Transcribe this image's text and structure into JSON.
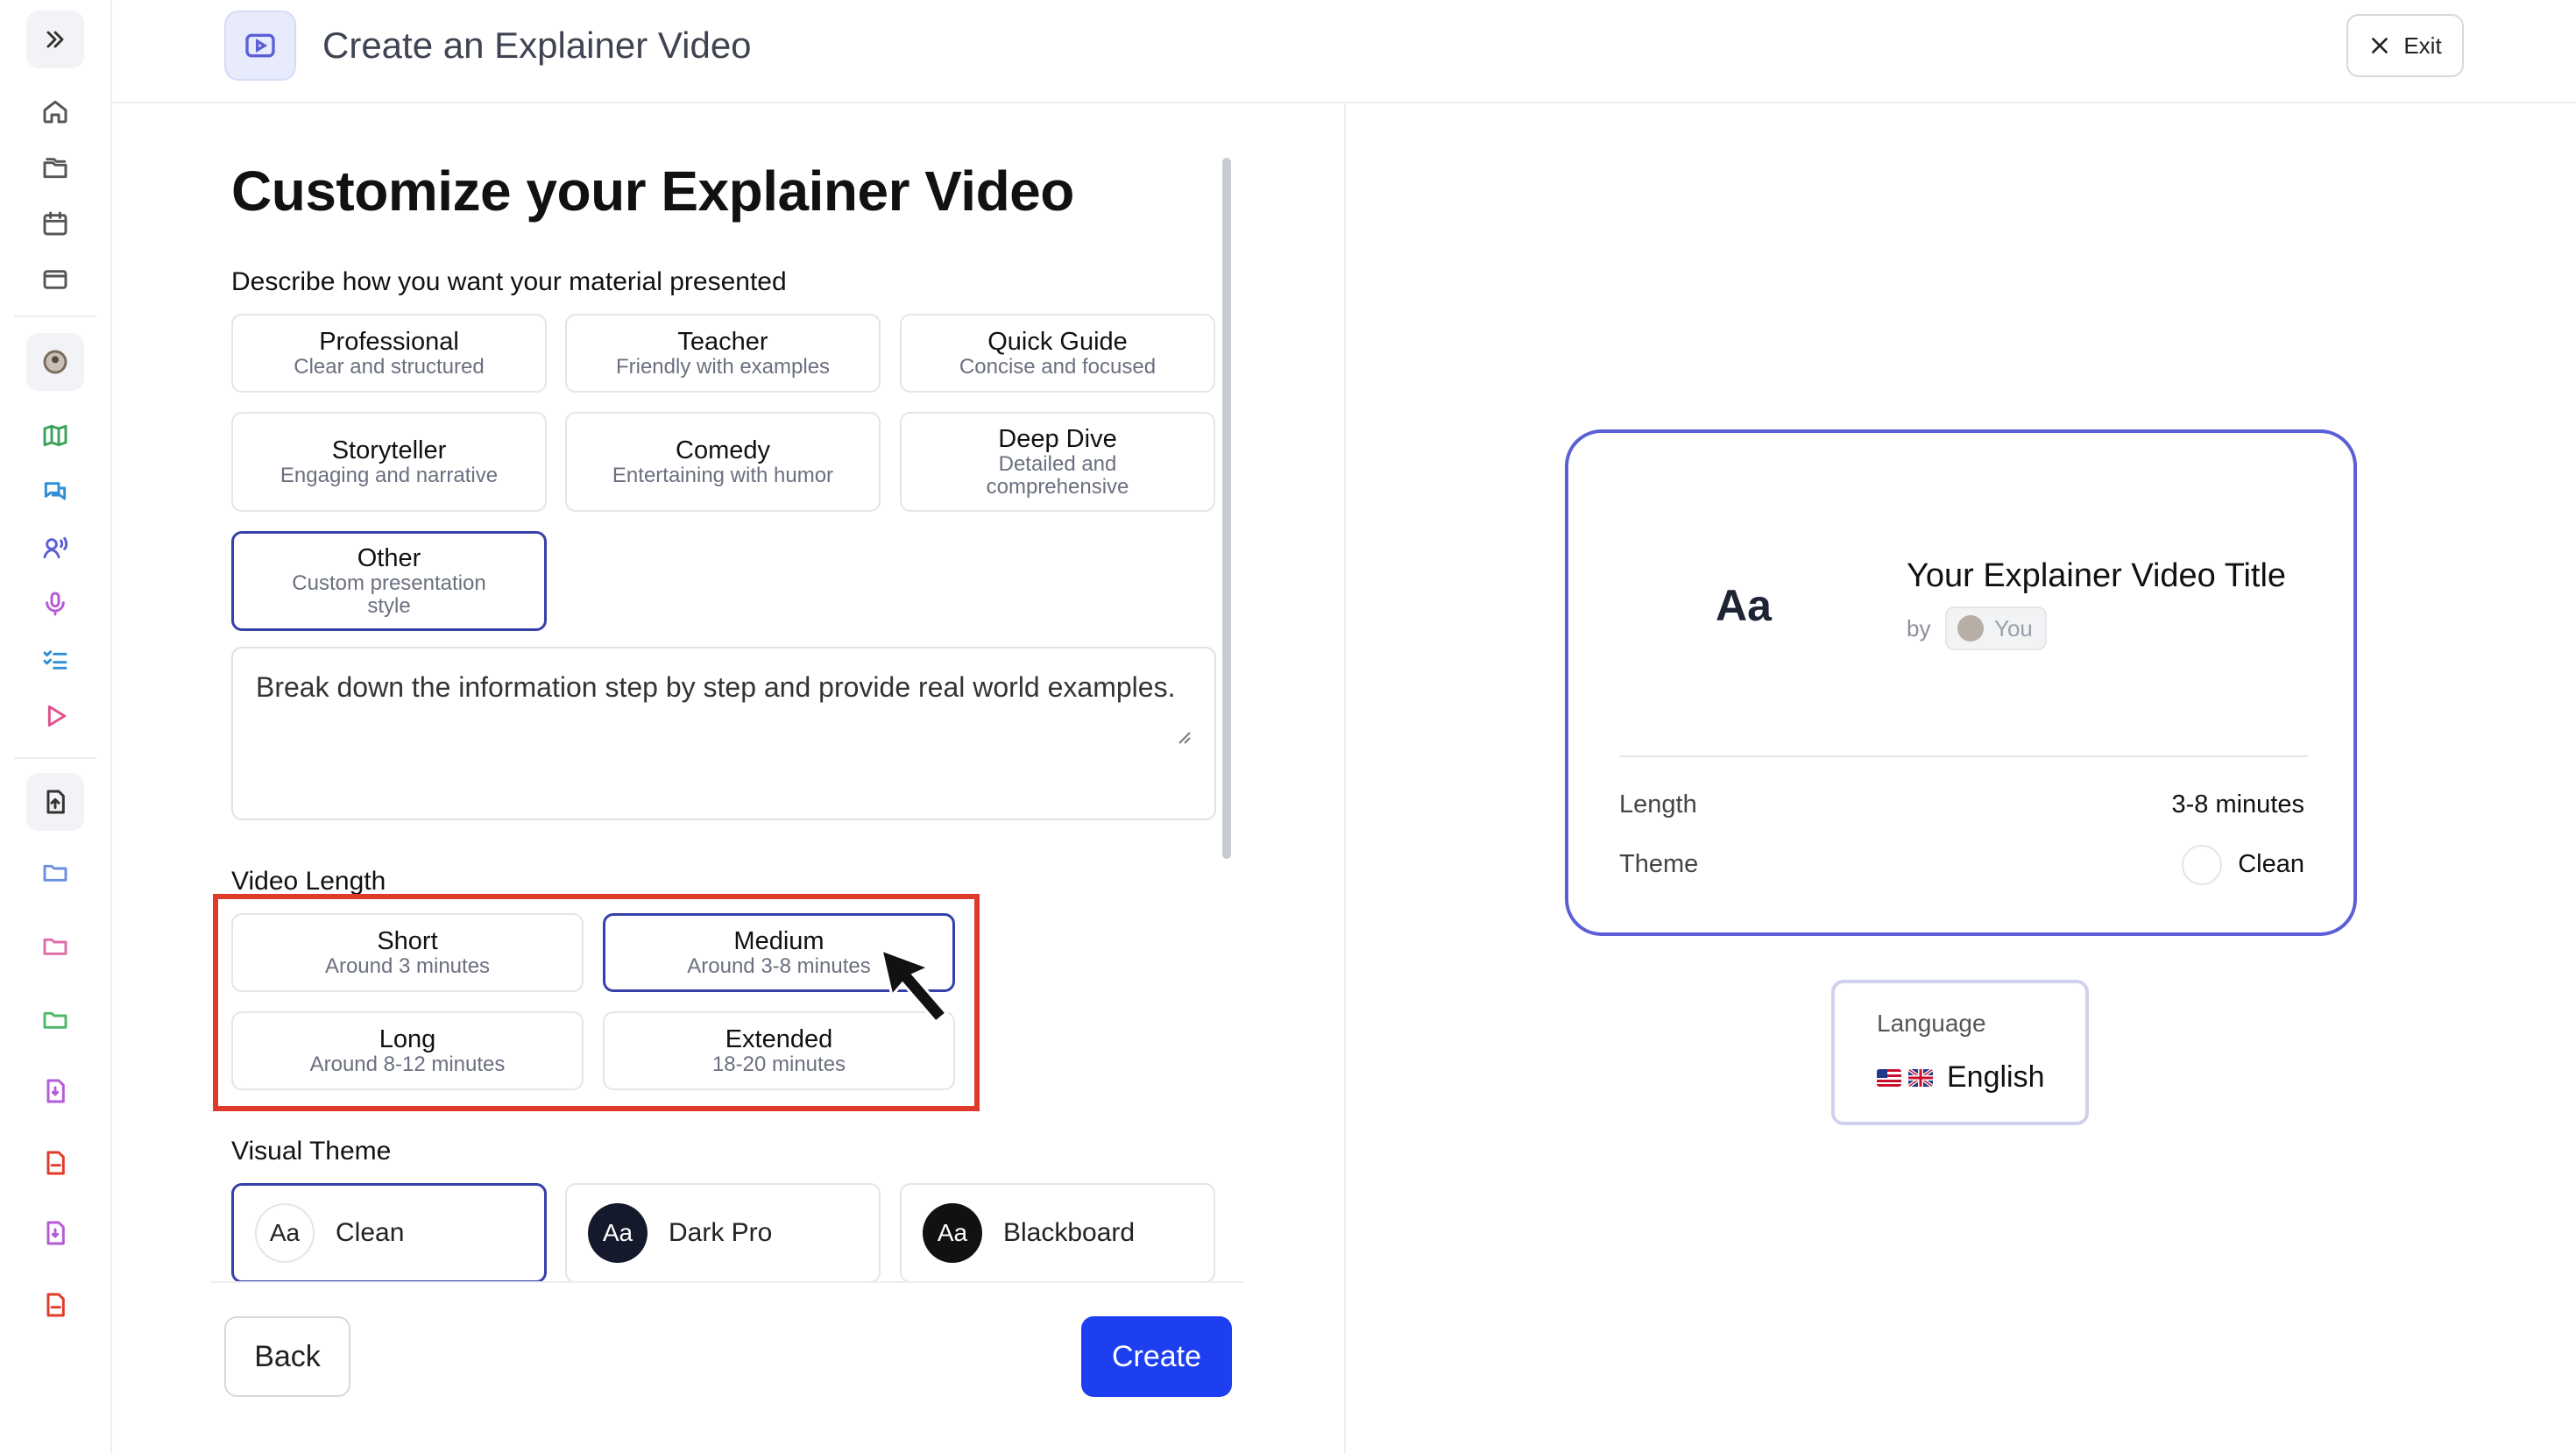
{
  "header": {
    "title": "Create an Explainer Video",
    "exit_label": "Exit"
  },
  "form": {
    "title": "Customize your Explainer Video",
    "style_label": "Describe how you want your material presented",
    "styles": [
      {
        "title": "Professional",
        "subtitle": "Clear and structured"
      },
      {
        "title": "Teacher",
        "subtitle": "Friendly with examples"
      },
      {
        "title": "Quick Guide",
        "subtitle": "Concise and focused"
      },
      {
        "title": "Storyteller",
        "subtitle": "Engaging and narrative"
      },
      {
        "title": "Comedy",
        "subtitle": "Entertaining with humor"
      },
      {
        "title": "Deep Dive",
        "subtitle": "Detailed and comprehensive"
      },
      {
        "title": "Other",
        "subtitle": "Custom presentation style"
      }
    ],
    "custom_text": "Break down the information step by step and provide real world examples.",
    "length_label": "Video Length",
    "lengths": [
      {
        "title": "Short",
        "subtitle": "Around 3 minutes"
      },
      {
        "title": "Medium",
        "subtitle": "Around 3-8 minutes"
      },
      {
        "title": "Long",
        "subtitle": "Around 8-12 minutes"
      },
      {
        "title": "Extended",
        "subtitle": "18-20 minutes"
      }
    ],
    "theme_label": "Visual Theme",
    "themes": [
      {
        "glyph": "Aa",
        "name": "Clean"
      },
      {
        "glyph": "Aa",
        "name": "Dark Pro"
      },
      {
        "glyph": "Aa",
        "name": "Blackboard"
      }
    ],
    "back_label": "Back",
    "create_label": "Create"
  },
  "preview": {
    "glyph": "Aa",
    "title": "Your Explainer Video Title",
    "by": "by",
    "author": "You",
    "length_key": "Length",
    "length_val": "3-8 minutes",
    "theme_key": "Theme",
    "theme_val": "Clean",
    "language_label": "Language",
    "language": "English"
  },
  "colors": {
    "accent": "#1d3ff0",
    "selected_border": "#3540a8",
    "preview_border": "#5b5fd6",
    "highlight": "#e03a2a"
  }
}
